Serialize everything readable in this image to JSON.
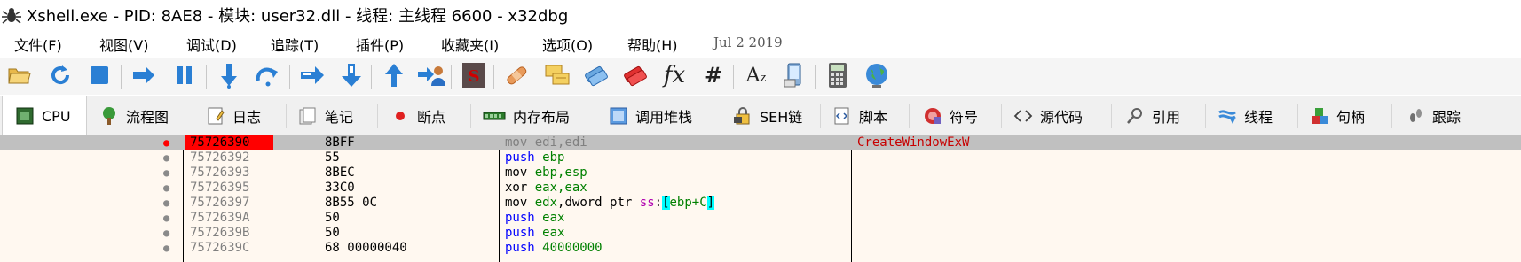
{
  "window": {
    "title": "Xshell.exe - PID: 8AE8 - 模块: user32.dll - 线程: 主线程 6600 - x32dbg",
    "app_icon": "bug-icon"
  },
  "menu": {
    "items": [
      "文件(F)",
      "视图(V)",
      "调试(D)",
      "追踪(T)",
      "插件(P)",
      "收藏夹(I)",
      "选项(O)",
      "帮助(H)"
    ],
    "date": "Jul 2 2019"
  },
  "toolbar": {
    "buttons": [
      "open-icon",
      "restart-icon",
      "stop-icon",
      "run-icon",
      "pause-icon",
      "step-into-icon",
      "step-over-icon",
      "trace-into-icon",
      "trace-over-icon",
      "execute-till-return-icon",
      "run-to-user-code-icon",
      "scylla-icon",
      "patch-icon",
      "comments-icon",
      "labels-icon",
      "bookmarks-icon",
      "functions-icon",
      "hash-icon",
      "font-icon",
      "device-icon",
      "calculator-icon",
      "globe-icon"
    ],
    "fx_label": "fx",
    "hash_label": "#",
    "az_label": "A",
    "az_sub": "z"
  },
  "tabs": [
    {
      "label": "CPU",
      "icon": "cpu-icon"
    },
    {
      "label": "流程图",
      "icon": "graph-icon"
    },
    {
      "label": "日志",
      "icon": "log-icon"
    },
    {
      "label": "笔记",
      "icon": "notes-icon"
    },
    {
      "label": "断点",
      "icon": "breakpoint-icon"
    },
    {
      "label": "内存布局",
      "icon": "memory-map-icon"
    },
    {
      "label": "调用堆栈",
      "icon": "call-stack-icon"
    },
    {
      "label": "SEH链",
      "icon": "seh-icon"
    },
    {
      "label": "脚本",
      "icon": "script-icon"
    },
    {
      "label": "符号",
      "icon": "symbols-icon"
    },
    {
      "label": "源代码",
      "icon": "source-icon"
    },
    {
      "label": "引用",
      "icon": "references-icon"
    },
    {
      "label": "线程",
      "icon": "threads-icon"
    },
    {
      "label": "句柄",
      "icon": "handles-icon"
    },
    {
      "label": "跟踪",
      "icon": "trace-icon"
    }
  ],
  "disasm": {
    "rows": [
      {
        "addr": "75726390",
        "bytes": "8BFF",
        "mnemonic": "mov",
        "ops": "edi,edi",
        "comment": "CreateWindowExW"
      },
      {
        "addr": "75726392",
        "bytes": "55",
        "mnemonic": "push",
        "ops": "ebp"
      },
      {
        "addr": "75726393",
        "bytes": "8BEC",
        "mnemonic": "mov",
        "ops": "ebp,esp"
      },
      {
        "addr": "75726395",
        "bytes": "33C0",
        "mnemonic": "xor",
        "ops": "eax,eax"
      },
      {
        "addr": "75726397",
        "bytes": "8B55 0C",
        "mnemonic": "mov",
        "ops": "edx,dword ptr ss:[ebp+C]"
      },
      {
        "addr": "7572639A",
        "bytes": "50",
        "mnemonic": "push",
        "ops": "eax"
      },
      {
        "addr": "7572639B",
        "bytes": "50",
        "mnemonic": "push",
        "ops": "eax"
      },
      {
        "addr": "7572639C",
        "bytes": "68 00000040",
        "mnemonic": "push",
        "ops": "40000000"
      }
    ]
  },
  "colors": {
    "breakpoint": "#ff0000",
    "selected_row": "#c0c0c0",
    "disasm_bg": "#fff8f0",
    "register": "#008000",
    "push": "#0000ff",
    "segment": "#b000b0",
    "bracket_highlight": "#00ffff",
    "comment": "#c80000"
  }
}
